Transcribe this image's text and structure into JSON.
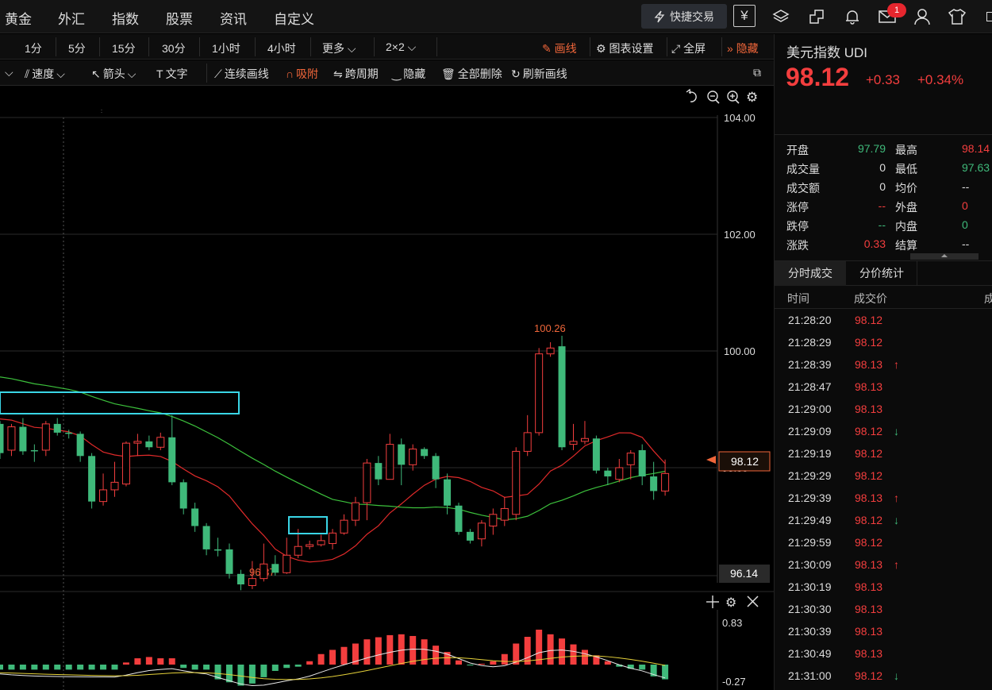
{
  "nav": {
    "items": [
      "黄金",
      "外汇",
      "指数",
      "股票",
      "资讯",
      "自定义"
    ],
    "quick_trade": "快捷交易",
    "badge_count": "1"
  },
  "toolbar": {
    "periods": [
      "1分",
      "5分",
      "15分",
      "30分",
      "1小时",
      "4小时",
      "更多",
      "2×2"
    ],
    "draw": "画线",
    "chart_settings": "图表设置",
    "fullscreen": "全屏",
    "hide": "隐藏"
  },
  "drawtools": {
    "speed": "速度",
    "arrow": "箭头",
    "text": "文字",
    "continuous": "连续画线",
    "snap": "吸附",
    "cross_period": "跨周期",
    "hide": "隐藏",
    "delete_all": "全部删除",
    "refresh": "刷新画线"
  },
  "chart": {
    "y_labels": [
      "104.00",
      "102.00",
      "100.00"
    ],
    "last_price": "98.12",
    "low_axis": "96.14",
    "high_label": "100.26",
    "low_label": "96.37",
    "macd_top": "0.83",
    "macd_bottom": "-0.27"
  },
  "quote": {
    "name": "美元指数  UDI",
    "price": "98.12",
    "change": "+0.33",
    "change_pct": "+0.34%",
    "left": [
      {
        "label": "开盘",
        "value": "97.79",
        "color": "green"
      },
      {
        "label": "成交量",
        "value": "0",
        "color": "white"
      },
      {
        "label": "成交额",
        "value": "0",
        "color": "white"
      },
      {
        "label": "涨停",
        "value": "--",
        "color": "red"
      },
      {
        "label": "跌停",
        "value": "--",
        "color": "green"
      },
      {
        "label": "涨跌",
        "value": "0.33",
        "color": "red"
      }
    ],
    "right": [
      {
        "label": "最高",
        "value": "98.14",
        "color": "red"
      },
      {
        "label": "最低",
        "value": "97.63",
        "color": "green"
      },
      {
        "label": "均价",
        "value": "--",
        "color": "white"
      },
      {
        "label": "外盘",
        "value": "0",
        "color": "red"
      },
      {
        "label": "内盘",
        "value": "0",
        "color": "green"
      },
      {
        "label": "结算",
        "value": "--",
        "color": "white"
      }
    ]
  },
  "trades_panel": {
    "tabs": [
      "分时成交",
      "分价统计"
    ],
    "headers": [
      "时间",
      "成交价",
      "成"
    ],
    "rows": [
      {
        "time": "21:28:20",
        "price": "98.12",
        "arrow": ""
      },
      {
        "time": "21:28:29",
        "price": "98.12",
        "arrow": ""
      },
      {
        "time": "21:28:39",
        "price": "98.13",
        "arrow": "↑"
      },
      {
        "time": "21:28:47",
        "price": "98.13",
        "arrow": ""
      },
      {
        "time": "21:29:00",
        "price": "98.13",
        "arrow": ""
      },
      {
        "time": "21:29:09",
        "price": "98.12",
        "arrow": "↓"
      },
      {
        "time": "21:29:19",
        "price": "98.12",
        "arrow": ""
      },
      {
        "time": "21:29:29",
        "price": "98.12",
        "arrow": ""
      },
      {
        "time": "21:29:39",
        "price": "98.13",
        "arrow": "↑"
      },
      {
        "time": "21:29:49",
        "price": "98.12",
        "arrow": "↓"
      },
      {
        "time": "21:29:59",
        "price": "98.12",
        "arrow": ""
      },
      {
        "time": "21:30:09",
        "price": "98.13",
        "arrow": "↑"
      },
      {
        "time": "21:30:19",
        "price": "98.13",
        "arrow": ""
      },
      {
        "time": "21:30:30",
        "price": "98.13",
        "arrow": ""
      },
      {
        "time": "21:30:39",
        "price": "98.13",
        "arrow": ""
      },
      {
        "time": "21:30:49",
        "price": "98.13",
        "arrow": ""
      },
      {
        "time": "21:31:00",
        "price": "98.12",
        "arrow": "↓"
      }
    ]
  },
  "chart_data": {
    "type": "candlestick",
    "symbol": "UDI",
    "y_range": [
      96.14,
      104.0
    ],
    "candles": [
      [
        98.75,
        98.25,
        98.8,
        98.15
      ],
      [
        98.3,
        98.7,
        98.75,
        98.2
      ],
      [
        98.7,
        98.28,
        98.85,
        98.22
      ],
      [
        98.3,
        98.28,
        98.4,
        98.1
      ],
      [
        98.3,
        98.75,
        98.8,
        98.2
      ],
      [
        98.75,
        98.6,
        98.85,
        98.55
      ],
      [
        98.6,
        98.58,
        98.65,
        98.5
      ],
      [
        98.58,
        98.2,
        98.62,
        98.1
      ],
      [
        98.2,
        97.42,
        98.25,
        97.3
      ],
      [
        97.42,
        97.62,
        97.9,
        97.35
      ],
      [
        97.62,
        97.75,
        98.1,
        97.5
      ],
      [
        97.72,
        98.42,
        98.45,
        97.68
      ],
      [
        98.42,
        98.45,
        98.58,
        98.2
      ],
      [
        98.45,
        98.35,
        98.55,
        98.3
      ],
      [
        98.35,
        98.52,
        98.6,
        98.3
      ],
      [
        98.52,
        97.75,
        98.9,
        97.7
      ],
      [
        97.75,
        97.3,
        97.8,
        97.2
      ],
      [
        97.3,
        97.0,
        97.4,
        96.9
      ],
      [
        97.0,
        96.6,
        97.05,
        96.5
      ],
      [
        96.6,
        96.58,
        96.8,
        96.48
      ],
      [
        96.6,
        96.18,
        96.7,
        96.1
      ],
      [
        96.18,
        96.0,
        96.25,
        95.9
      ],
      [
        95.98,
        96.1,
        96.4,
        95.92
      ],
      [
        96.1,
        96.35,
        96.7,
        96.05
      ],
      [
        96.35,
        96.2,
        96.5,
        96.15
      ],
      [
        96.2,
        96.5,
        96.8,
        96.18
      ],
      [
        96.5,
        96.65,
        96.95,
        96.45
      ],
      [
        96.65,
        96.68,
        96.75,
        96.6
      ],
      [
        96.68,
        96.75,
        96.85,
        96.65
      ],
      [
        96.7,
        96.88,
        96.95,
        96.6
      ],
      [
        96.88,
        97.1,
        97.2,
        96.85
      ],
      [
        97.1,
        97.4,
        97.5,
        97.0
      ],
      [
        97.4,
        98.08,
        98.15,
        97.1
      ],
      [
        98.08,
        97.8,
        98.2,
        97.7
      ],
      [
        97.8,
        98.4,
        98.58,
        97.8
      ],
      [
        98.4,
        98.05,
        98.5,
        97.7
      ],
      [
        98.05,
        98.32,
        98.4,
        97.95
      ],
      [
        98.32,
        98.2,
        98.35,
        98.15
      ],
      [
        98.2,
        97.8,
        98.25,
        97.65
      ],
      [
        97.8,
        97.35,
        97.9,
        97.2
      ],
      [
        97.35,
        96.9,
        97.4,
        96.85
      ],
      [
        96.9,
        96.75,
        96.95,
        96.7
      ],
      [
        96.78,
        97.05,
        97.1,
        96.65
      ],
      [
        97.0,
        97.2,
        97.3,
        96.85
      ],
      [
        97.1,
        97.3,
        97.5,
        97.0
      ],
      [
        97.2,
        98.28,
        98.35,
        97.1
      ],
      [
        98.28,
        98.6,
        98.9,
        98.2
      ],
      [
        98.6,
        99.95,
        100.05,
        98.55
      ],
      [
        99.95,
        100.05,
        100.15,
        99.9
      ],
      [
        100.08,
        98.35,
        100.26,
        98.3
      ],
      [
        98.4,
        98.45,
        98.75,
        98.3
      ],
      [
        98.45,
        98.5,
        98.8,
        98.4
      ],
      [
        98.5,
        97.95,
        98.55,
        97.9
      ],
      [
        97.95,
        97.85,
        98.0,
        97.7
      ],
      [
        97.8,
        98.0,
        98.15,
        97.75
      ],
      [
        98.05,
        98.25,
        98.3,
        97.8
      ],
      [
        98.3,
        97.85,
        98.4,
        97.7
      ],
      [
        97.85,
        97.6,
        98.1,
        97.45
      ],
      [
        97.6,
        97.9,
        98.14,
        97.52
      ]
    ],
    "macd": [
      -0.12,
      -0.12,
      -0.12,
      -0.12,
      -0.12,
      -0.12,
      -0.12,
      -0.12,
      -0.12,
      -0.12,
      -0.12,
      0.05,
      0.15,
      0.18,
      0.15,
      0.15,
      -0.08,
      -0.12,
      -0.12,
      -0.35,
      -0.42,
      -0.5,
      -0.45,
      -0.3,
      -0.15,
      -0.08,
      -0.05,
      0.08,
      0.25,
      0.35,
      0.42,
      0.5,
      0.6,
      0.65,
      0.7,
      0.72,
      0.68,
      0.6,
      0.45,
      0.3,
      0.1,
      -0.02,
      0.02,
      0.08,
      0.25,
      0.5,
      0.66,
      0.83,
      0.72,
      0.62,
      0.48,
      0.35,
      0.22,
      0.08,
      -0.05,
      -0.1,
      -0.12,
      -0.28,
      -0.35
    ]
  }
}
